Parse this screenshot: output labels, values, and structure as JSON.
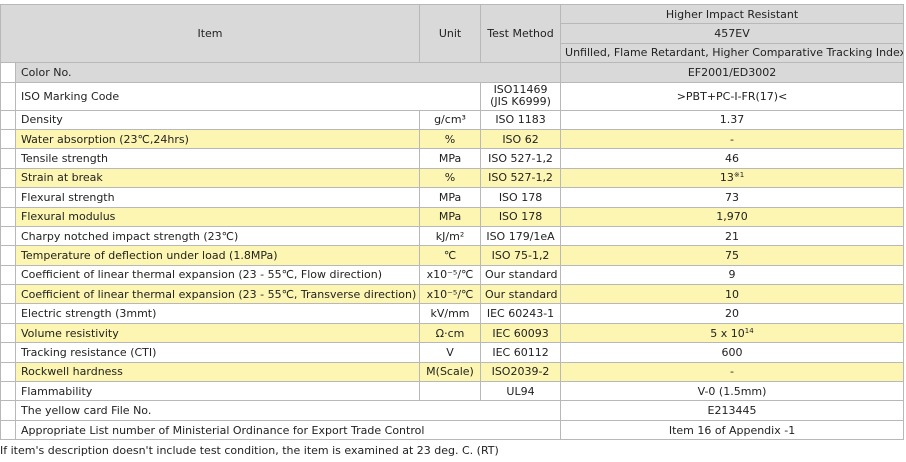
{
  "header": {
    "item": "Item",
    "unit": "Unit",
    "test_method": "Test Method",
    "grade_group": "Higher Impact Resistant",
    "grade": "457EV",
    "grade_desc": "Unfilled, Flame Retardant, Higher Comparative Tracking Index."
  },
  "color_row": {
    "label": "Color No.",
    "value": "EF2001/ED3002"
  },
  "iso_row": {
    "label": "ISO Marking Code",
    "method_line1": "ISO11469",
    "method_line2": "(JIS K6999)",
    "value": ">PBT+PC-I-FR(17)<"
  },
  "rows": [
    {
      "label": "Density",
      "unit": "g/cm³",
      "method": "ISO 1183",
      "value": "1.37",
      "highlight": false
    },
    {
      "label": "Water absorption (23℃,24hrs)",
      "unit": "%",
      "method": "ISO 62",
      "value": "-",
      "highlight": true
    },
    {
      "label": "Tensile strength",
      "unit": "MPa",
      "method": "ISO 527-1,2",
      "value": "46",
      "highlight": false
    },
    {
      "label": "Strain at break",
      "unit": "%",
      "method": "ISO 527-1,2",
      "value": "13",
      "value_sup": "※1",
      "highlight": true
    },
    {
      "label": "Flexural strength",
      "unit": "MPa",
      "method": "ISO 178",
      "value": "73",
      "highlight": false
    },
    {
      "label": "Flexural modulus",
      "unit": "MPa",
      "method": "ISO 178",
      "value": "1,970",
      "highlight": true
    },
    {
      "label": "Charpy notched impact strength (23℃)",
      "unit": "kJ/m²",
      "method": "ISO 179/1eA",
      "value": "21",
      "highlight": false
    },
    {
      "label": "Temperature of deflection under load (1.8MPa)",
      "unit": "℃",
      "method": "ISO 75-1,2",
      "value": "75",
      "highlight": true
    },
    {
      "label": "Coefficient of linear thermal expansion (23 - 55℃, Flow direction)",
      "unit": "x10⁻⁵/℃",
      "method": "Our standard",
      "value": "9",
      "highlight": false
    },
    {
      "label": "Coefficient of linear thermal expansion (23 - 55℃, Transverse direction)",
      "unit": "x10⁻⁵/℃",
      "method": "Our standard",
      "value": "10",
      "highlight": true
    },
    {
      "label": "Electric strength (3mmt)",
      "unit": "kV/mm",
      "method": "IEC 60243-1",
      "value": "20",
      "highlight": false
    },
    {
      "label": "Volume resistivity",
      "unit": "Ω·cm",
      "method": "IEC 60093",
      "value": "5 x 10",
      "value_sup": "14",
      "highlight": true
    },
    {
      "label": "Tracking resistance (CTI)",
      "unit": "V",
      "method": "IEC 60112",
      "value": "600",
      "highlight": false
    },
    {
      "label": "Rockwell hardness",
      "unit": "M(Scale)",
      "method": "ISO2039-2",
      "value": "-",
      "highlight": true
    },
    {
      "label": "Flammability",
      "unit": "",
      "method": "UL94",
      "value": "V-0 (1.5mm)",
      "highlight": false
    }
  ],
  "yellow_card": {
    "label": "The yellow card File No.",
    "value": "E213445"
  },
  "export_row": {
    "label": "Appropriate List number of Ministerial Ordinance for Export Trade Control",
    "value": "Item 16 of Appendix -1"
  },
  "footnote": "If item's description doesn't include test condition, the item is examined at 23 deg. C. (RT)"
}
